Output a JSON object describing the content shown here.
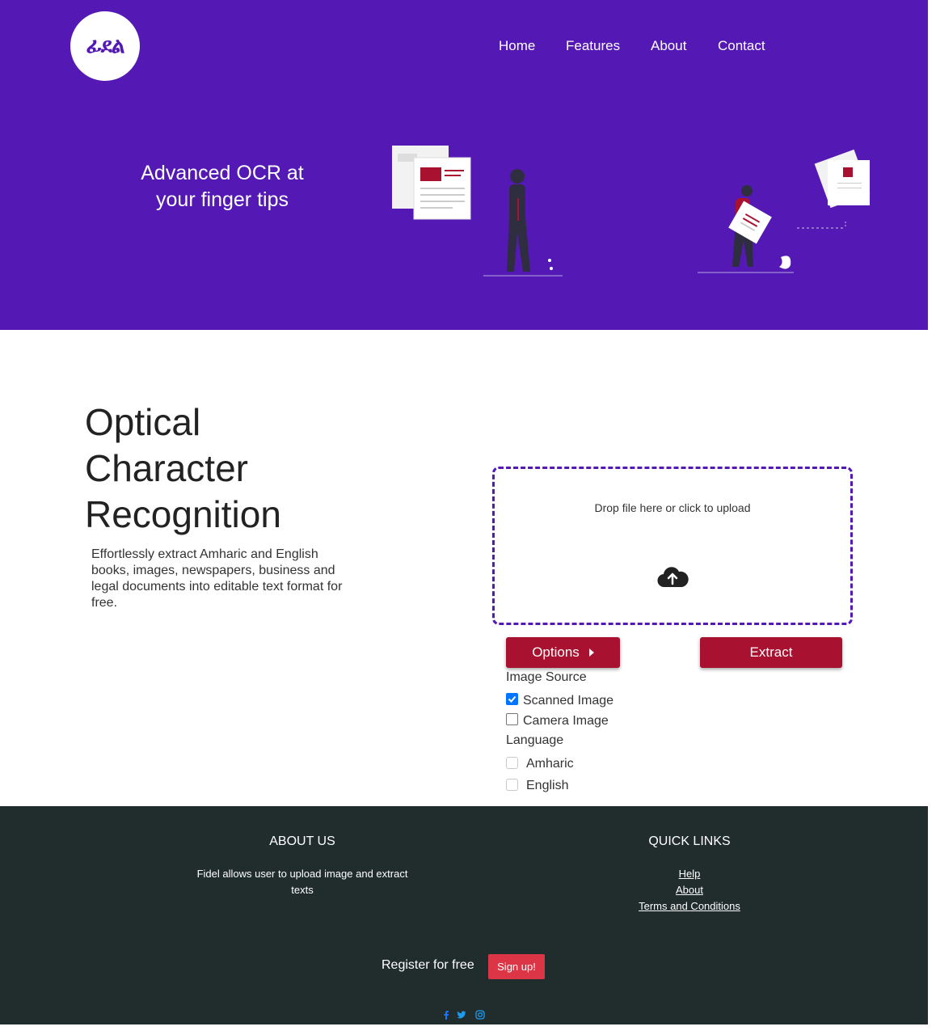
{
  "header": {
    "logo_text": "ፊደል",
    "nav": [
      "Home",
      "Features",
      "About",
      "Contact"
    ]
  },
  "hero": {
    "tagline_line1": "Advanced OCR at",
    "tagline_line2": "your finger tips"
  },
  "main": {
    "title_lines": [
      "Optical",
      "Character",
      "Recognition"
    ],
    "description": "Effortlessly extract Amharic and English books, images, newspapers, business and legal documents into editable text format for free.",
    "dropzone_text": "Drop file here or click to upload",
    "options_label": "Options",
    "extract_label": "Extract",
    "image_source_label": "Image Source",
    "image_sources": [
      {
        "label": "Scanned Image",
        "checked": true
      },
      {
        "label": "Camera Image",
        "checked": false
      }
    ],
    "language_label": "Language",
    "languages": [
      {
        "label": "Amharic",
        "checked": false
      },
      {
        "label": "English",
        "checked": false
      }
    ]
  },
  "footer": {
    "about_heading": "ABOUT US",
    "about_text_line1": "Fidel allows user to upload image and extract",
    "about_text_line2": "texts",
    "links_heading": "QUICK LINKS",
    "links": [
      "Help",
      "About",
      "Terms and Conditions"
    ],
    "register_text": "Register for free",
    "signup_label": "Sign up!",
    "social_icons": [
      "facebook-icon",
      "twitter-icon",
      "instagram-icon"
    ]
  },
  "colors": {
    "brand_purple": "#5419b4",
    "button_red": "#a8112f",
    "signup_red": "#dc3545",
    "footer_bg": "#212d2d"
  }
}
